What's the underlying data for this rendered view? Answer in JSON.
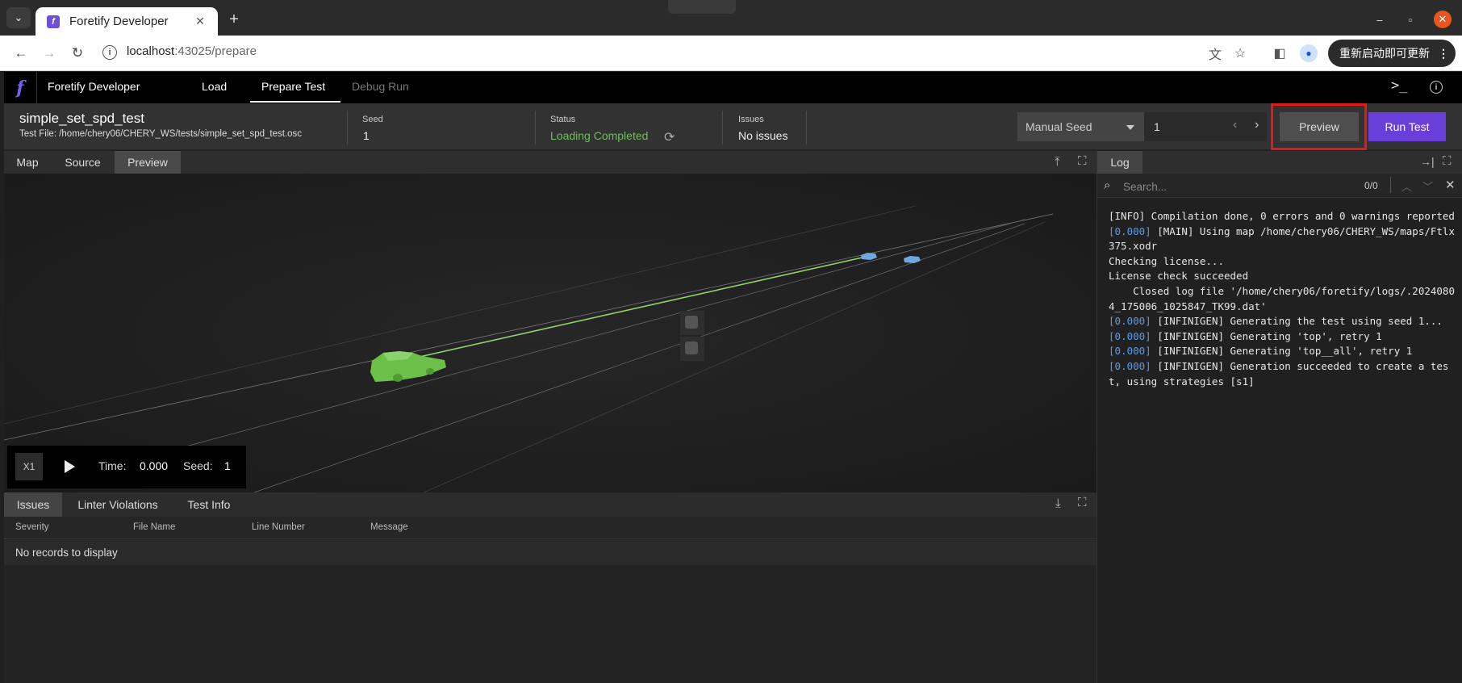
{
  "browser": {
    "tab_title": "Foretify Developer",
    "favicon_letter": "f",
    "tab_close": "✕",
    "new_tab": "+",
    "url_host": "localhost",
    "url_path": ":43025/prepare",
    "update_label": "重新启动即可更新",
    "update_more": "⋮",
    "window": {
      "minimize": "–",
      "maximize": "▫",
      "close": "✕"
    },
    "icons": [
      "chevron-down-icon",
      "back-icon",
      "forward-icon",
      "reload-icon",
      "info-icon",
      "translate-icon",
      "star-icon",
      "sidebar-icon",
      "profile-icon"
    ]
  },
  "app": {
    "logo": "f",
    "name": "Foretify Developer",
    "nav": [
      "Load",
      "Prepare Test",
      "Debug Run"
    ],
    "active_nav": "Prepare Test"
  },
  "test": {
    "name": "simple_set_spd_test",
    "file": "Test File: /home/chery06/CHERY_WS/tests/simple_set_spd_test.osc",
    "seed_label": "Seed",
    "seed_value": "1",
    "status_label": "Status",
    "status_value": "Loading Completed",
    "issues_label": "Issues",
    "issues_value": "No issues",
    "seed_mode": "Manual Seed",
    "seed_input": "1",
    "preview_button": "Preview",
    "run_test_button": "Run Test"
  },
  "left_panel": {
    "tabs": [
      "Map",
      "Source",
      "Preview"
    ],
    "active_tab": "Preview"
  },
  "player": {
    "speed": "X1",
    "time_label": "Time:",
    "time_value": "0.000",
    "seed_label": "Seed:",
    "seed_value": "1"
  },
  "issues_panel": {
    "tabs": [
      "Issues",
      "Linter Violations",
      "Test Info"
    ],
    "active_tab": "Issues",
    "columns": [
      "Severity",
      "File Name",
      "Line Number",
      "Message"
    ],
    "empty_message": "No records to display"
  },
  "log_panel": {
    "tab": "Log",
    "search_placeholder": "Search...",
    "match_count": "0/0",
    "lines": [
      {
        "ts": "",
        "text": "[INFO] Compilation done, 0 errors and 0 warnings reported"
      },
      {
        "ts": "[0.000]",
        "text": " [MAIN] Using map /home/chery06/CHERY_WS/maps/Ftlx375.xodr"
      },
      {
        "ts": "",
        "text": "Checking license..."
      },
      {
        "ts": "",
        "text": "License check succeeded"
      },
      {
        "ts": "",
        "text": "    Closed log file '/home/chery06/foretify/logs/.20240804_175006_1025847_TK99.dat'"
      },
      {
        "ts": "[0.000]",
        "text": " [INFINIGEN] Generating the test using seed 1..."
      },
      {
        "ts": "[0.000]",
        "text": " [INFINIGEN] Generating 'top', retry 1"
      },
      {
        "ts": "[0.000]",
        "text": " [INFINIGEN] Generating 'top__all', retry 1"
      },
      {
        "ts": "[0.000]",
        "text": " [INFINIGEN] Generation succeeded to create a test, using strategies [s1]"
      }
    ]
  },
  "colors": {
    "accent": "#6a3ed8",
    "status_ok": "#6fbf5a",
    "ego_vehicle": "#6cc04a",
    "other_vehicles": "#6fa8dc",
    "highlight": "#e01919",
    "log_timestamp": "#5b9be6"
  }
}
